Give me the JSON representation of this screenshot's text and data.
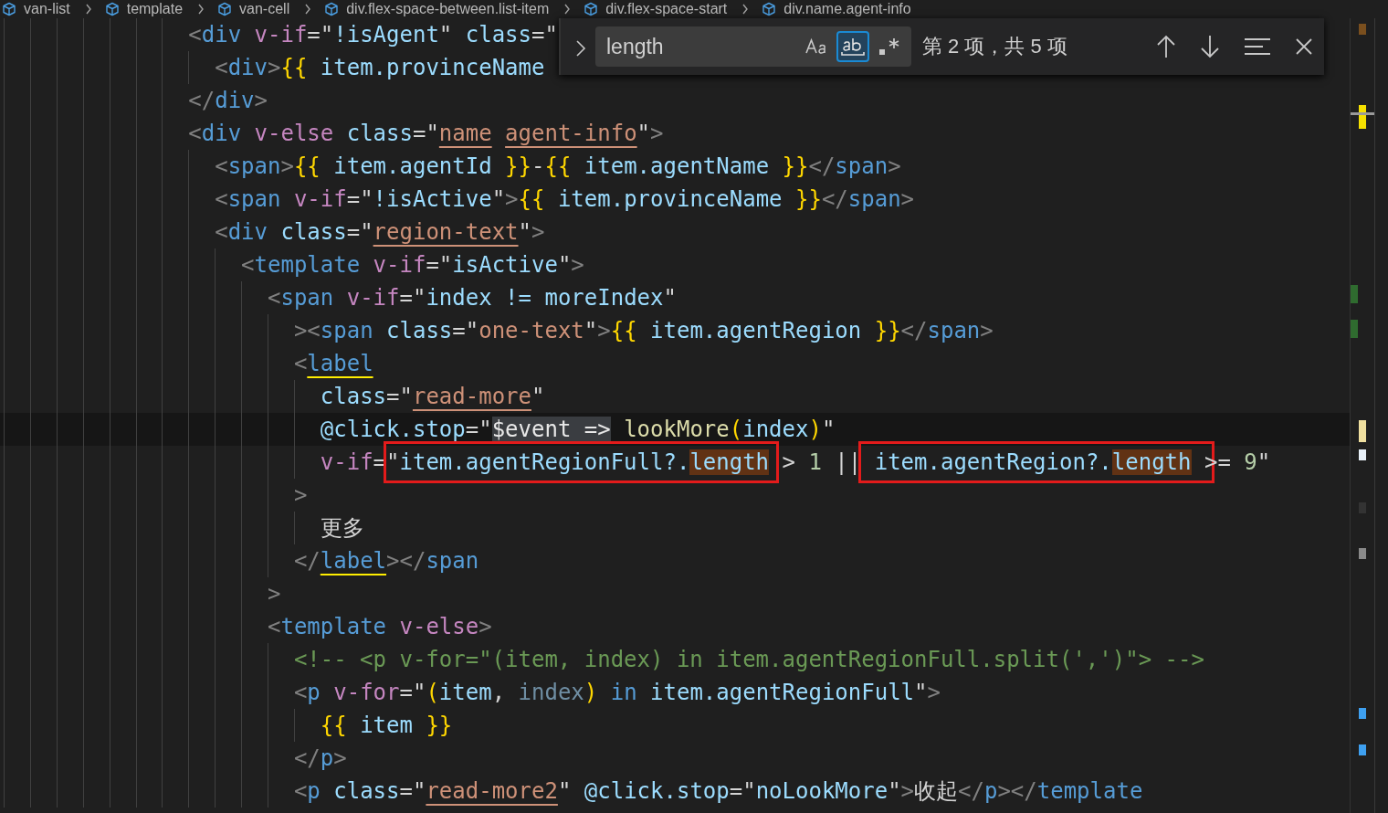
{
  "breadcrumb": [
    {
      "label": "van-list"
    },
    {
      "label": "template"
    },
    {
      "label": "van-cell"
    },
    {
      "label": "div.flex-space-between.list-item"
    },
    {
      "label": "div.flex-space-start"
    },
    {
      "label": "div.name.agent-info"
    }
  ],
  "find_widget": {
    "query": "length",
    "match_case": false,
    "whole_word": true,
    "regex": false,
    "result": "第 2 项，共 5 项"
  },
  "lines": [
    {
      "tokens": [
        {
          "kind": "br",
          "text": "<"
        },
        {
          "kind": "tag",
          "text": "div"
        },
        {
          "kind": "dir",
          "text": " v-if"
        },
        {
          "kind": "op",
          "text": "=\""
        },
        {
          "kind": "expr",
          "text": "!isAgent"
        },
        {
          "kind": "op",
          "text": "\""
        },
        {
          "kind": "attr",
          "text": " class"
        },
        {
          "kind": "op",
          "text": "=\""
        }
      ],
      "children": [
        {
          "tokens": [
            {
              "kind": "br",
              "text": "<"
            },
            {
              "kind": "tag",
              "text": "div"
            },
            {
              "kind": "br",
              "text": ">"
            },
            {
              "kind": "mus",
              "text": "{{"
            },
            {
              "kind": "expr",
              "text": " item.provinceName"
            }
          ]
        }
      ]
    },
    {
      "tokens": [
        {
          "kind": "br",
          "text": "</"
        },
        {
          "kind": "tag",
          "text": "div"
        },
        {
          "kind": "br",
          "text": ">"
        }
      ]
    },
    {
      "tokens": [
        {
          "kind": "br",
          "text": "<"
        },
        {
          "kind": "tag",
          "text": "div"
        },
        {
          "kind": "dir",
          "text": " v-else"
        },
        {
          "kind": "attr",
          "text": " class"
        },
        {
          "kind": "op",
          "text": "=\""
        },
        {
          "kind": "str",
          "text": "name",
          "underline": true
        },
        {
          "kind": "str",
          "text": " agent-info",
          "underline": true
        },
        {
          "kind": "op",
          "text": "\""
        },
        {
          "kind": "br",
          "text": ">"
        }
      ],
      "children": [
        {
          "tokens": [
            {
              "kind": "br",
              "text": "<"
            },
            {
              "kind": "tag",
              "text": "span"
            },
            {
              "kind": "br",
              "text": ">"
            },
            {
              "kind": "mus",
              "text": "{{"
            },
            {
              "kind": "expr",
              "text": " item.agentId "
            },
            {
              "kind": "mus",
              "text": "}}"
            },
            {
              "kind": "op",
              "text": "-"
            },
            {
              "kind": "mus",
              "text": "{{"
            },
            {
              "kind": "expr",
              "text": " item.agentName "
            },
            {
              "kind": "mus",
              "text": "}}"
            },
            {
              "kind": "br",
              "text": "</"
            },
            {
              "kind": "tag",
              "text": "span"
            },
            {
              "kind": "br",
              "text": ">"
            }
          ]
        },
        {
          "tokens": [
            {
              "kind": "br",
              "text": "<"
            },
            {
              "kind": "tag",
              "text": "span"
            },
            {
              "kind": "dir",
              "text": " v-if"
            },
            {
              "kind": "op",
              "text": "=\""
            },
            {
              "kind": "expr",
              "text": "!isActive"
            },
            {
              "kind": "op",
              "text": "\""
            },
            {
              "kind": "br",
              "text": ">"
            },
            {
              "kind": "mus",
              "text": "{{"
            },
            {
              "kind": "expr",
              "text": " item.provinceName "
            },
            {
              "kind": "mus",
              "text": "}}"
            },
            {
              "kind": "br",
              "text": "</"
            },
            {
              "kind": "tag",
              "text": "span"
            },
            {
              "kind": "br",
              "text": ">"
            }
          ]
        },
        {
          "tokens": [
            {
              "kind": "br",
              "text": "<"
            },
            {
              "kind": "tag",
              "text": "div"
            },
            {
              "kind": "attr",
              "text": " class"
            },
            {
              "kind": "op",
              "text": "=\""
            },
            {
              "kind": "str",
              "text": "region-text",
              "underline": true
            },
            {
              "kind": "op",
              "text": "\""
            },
            {
              "kind": "br",
              "text": ">"
            }
          ],
          "children": [
            {
              "tokens": [
                {
                  "kind": "br",
                  "text": "<"
                },
                {
                  "kind": "tag",
                  "text": "template"
                },
                {
                  "kind": "dir",
                  "text": " v-if"
                },
                {
                  "kind": "op",
                  "text": "=\""
                },
                {
                  "kind": "expr",
                  "text": "isActive"
                },
                {
                  "kind": "op",
                  "text": "\""
                },
                {
                  "kind": "br",
                  "text": ">"
                }
              ],
              "children": [
                {
                  "tokens": [
                    {
                      "kind": "br",
                      "text": "<"
                    },
                    {
                      "kind": "tag",
                      "text": "span"
                    },
                    {
                      "kind": "dir",
                      "text": " v-if"
                    },
                    {
                      "kind": "op",
                      "text": "=\""
                    },
                    {
                      "kind": "expr",
                      "text": "index != moreIndex"
                    },
                    {
                      "kind": "op",
                      "text": "\""
                    }
                  ],
                  "children": [
                    {
                      "tokens": [
                        {
                          "kind": "br",
                          "text": "><"
                        },
                        {
                          "kind": "tag",
                          "text": "span"
                        },
                        {
                          "kind": "attr",
                          "text": " class"
                        },
                        {
                          "kind": "op",
                          "text": "=\""
                        },
                        {
                          "kind": "str",
                          "text": "one-text"
                        },
                        {
                          "kind": "op",
                          "text": "\""
                        },
                        {
                          "kind": "br",
                          "text": ">"
                        },
                        {
                          "kind": "mus",
                          "text": "{{"
                        },
                        {
                          "kind": "expr",
                          "text": " item.agentRegion "
                        },
                        {
                          "kind": "mus",
                          "text": "}}"
                        },
                        {
                          "kind": "br",
                          "text": "</"
                        },
                        {
                          "kind": "tag",
                          "text": "span"
                        },
                        {
                          "kind": "br",
                          "text": ">"
                        }
                      ]
                    },
                    {
                      "tokens": [
                        {
                          "kind": "br",
                          "text": "<"
                        },
                        {
                          "kind": "tag",
                          "text": "label",
                          "paired": true
                        }
                      ],
                      "children": [
                        {
                          "tokens": [
                            {
                              "kind": "attr",
                              "text": "class"
                            },
                            {
                              "kind": "op",
                              "text": "=\""
                            },
                            {
                              "kind": "str",
                              "text": "read-more",
                              "underline": true
                            },
                            {
                              "kind": "op",
                              "text": "\""
                            }
                          ]
                        },
                        {
                          "current": true,
                          "tokens": [
                            {
                              "kind": "attr",
                              "text": "@click.stop"
                            },
                            {
                              "kind": "op",
                              "text": "=\""
                            },
                            {
                              "kind": "expr",
                              "text": "$event =>",
                              "highlight": true
                            },
                            {
                              "kind": "fn",
                              "text": " lookMore"
                            },
                            {
                              "kind": "paren",
                              "text": "("
                            },
                            {
                              "kind": "expr",
                              "text": "index"
                            },
                            {
                              "kind": "paren",
                              "text": ")"
                            },
                            {
                              "kind": "op",
                              "text": "\""
                            }
                          ]
                        },
                        {
                          "tokens": [
                            {
                              "kind": "dir",
                              "text": "v-if"
                            },
                            {
                              "kind": "op",
                              "text": "="
                            },
                            {
                              "kind": "annotation",
                              "tokens": [
                                {
                                  "kind": "op",
                                  "text": "\""
                                },
                                {
                                  "kind": "expr",
                                  "text": "item.agentRegionFull?."
                                },
                                {
                                  "kind": "expr",
                                  "text": "length",
                                  "match": true
                                }
                              ]
                            },
                            {
                              "kind": "op",
                              "text": " > "
                            },
                            {
                              "kind": "num",
                              "text": "1"
                            },
                            {
                              "kind": "op",
                              "text": " ||"
                            },
                            {
                              "kind": "annotation",
                              "tokens": [
                                {
                                  "kind": "expr",
                                  "text": " item.agentRegion?."
                                },
                                {
                                  "kind": "expr",
                                  "text": "length",
                                  "match": true
                                }
                              ]
                            },
                            {
                              "kind": "op",
                              "text": " >= "
                            },
                            {
                              "kind": "num",
                              "text": "9"
                            },
                            {
                              "kind": "op",
                              "text": "\""
                            }
                          ]
                        }
                      ]
                    },
                    {
                      "tokens": [
                        {
                          "kind": "br",
                          "text": ">"
                        }
                      ],
                      "children": [
                        {
                          "tokens": [
                            {
                              "kind": "op",
                              "text": "更多"
                            }
                          ]
                        }
                      ]
                    },
                    {
                      "tokens": [
                        {
                          "kind": "br",
                          "text": "</"
                        },
                        {
                          "kind": "tag",
                          "text": "label",
                          "paired": true
                        },
                        {
                          "kind": "br",
                          "text": "></"
                        },
                        {
                          "kind": "tag",
                          "text": "span"
                        }
                      ]
                    }
                  ]
                },
                {
                  "tokens": [
                    {
                      "kind": "br",
                      "text": ">"
                    }
                  ]
                },
                {
                  "tokens": [
                    {
                      "kind": "br",
                      "text": "<"
                    },
                    {
                      "kind": "tag",
                      "text": "template"
                    },
                    {
                      "kind": "dir",
                      "text": " v-else"
                    },
                    {
                      "kind": "br",
                      "text": ">"
                    }
                  ],
                  "children": [
                    {
                      "tokens": [
                        {
                          "kind": "com",
                          "text": "<!-- <p v-for=\"(item, index) in item.agentRegionFull.split(',')\"> -->"
                        }
                      ]
                    },
                    {
                      "tokens": [
                        {
                          "kind": "br",
                          "text": "<"
                        },
                        {
                          "kind": "tag",
                          "text": "p"
                        },
                        {
                          "kind": "dir",
                          "text": " v-for"
                        },
                        {
                          "kind": "op",
                          "text": "=\""
                        },
                        {
                          "kind": "paren",
                          "text": "("
                        },
                        {
                          "kind": "expr",
                          "text": "item"
                        },
                        {
                          "kind": "op",
                          "text": ", "
                        },
                        {
                          "kind": "unused",
                          "text": "index"
                        },
                        {
                          "kind": "paren",
                          "text": ")"
                        },
                        {
                          "kind": "kw",
                          "text": " in"
                        },
                        {
                          "kind": "expr",
                          "text": " item.agentRegionFull"
                        },
                        {
                          "kind": "op",
                          "text": "\""
                        },
                        {
                          "kind": "br",
                          "text": ">"
                        }
                      ],
                      "children": [
                        {
                          "tokens": [
                            {
                              "kind": "mus",
                              "text": "{{"
                            },
                            {
                              "kind": "expr",
                              "text": " item "
                            },
                            {
                              "kind": "mus",
                              "text": "}}"
                            }
                          ]
                        }
                      ]
                    },
                    {
                      "tokens": [
                        {
                          "kind": "br",
                          "text": "</"
                        },
                        {
                          "kind": "tag",
                          "text": "p"
                        },
                        {
                          "kind": "br",
                          "text": ">"
                        }
                      ]
                    },
                    {
                      "tokens": [
                        {
                          "kind": "br",
                          "text": "<"
                        },
                        {
                          "kind": "tag",
                          "text": "p"
                        },
                        {
                          "kind": "attr",
                          "text": " class"
                        },
                        {
                          "kind": "op",
                          "text": "=\""
                        },
                        {
                          "kind": "str",
                          "text": "read-more2",
                          "underline": true
                        },
                        {
                          "kind": "op",
                          "text": "\""
                        },
                        {
                          "kind": "attr",
                          "text": " @click.stop"
                        },
                        {
                          "kind": "op",
                          "text": "=\""
                        },
                        {
                          "kind": "expr",
                          "text": "noLookMore"
                        },
                        {
                          "kind": "op",
                          "text": "\""
                        },
                        {
                          "kind": "br",
                          "text": ">"
                        },
                        {
                          "kind": "op",
                          "text": "收起"
                        },
                        {
                          "kind": "br",
                          "text": "</"
                        },
                        {
                          "kind": "tag",
                          "text": "p"
                        },
                        {
                          "kind": "br",
                          "text": "></"
                        },
                        {
                          "kind": "tag",
                          "text": "template"
                        }
                      ]
                    }
                  ]
                }
              ]
            }
          ]
        }
      ]
    }
  ]
}
